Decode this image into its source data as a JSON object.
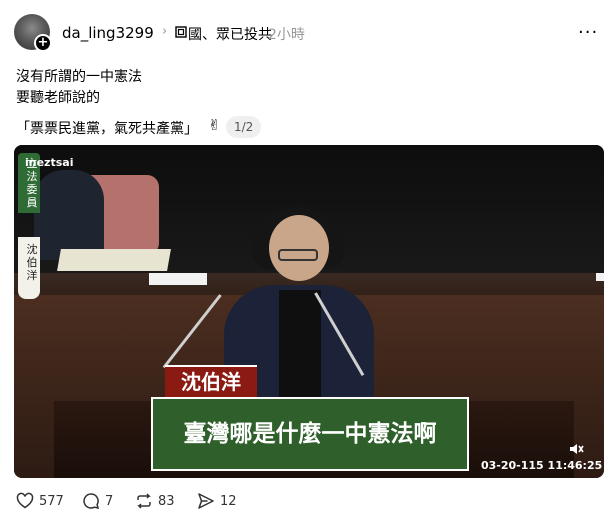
{
  "post": {
    "username": "da_ling3299",
    "community": "國、眾已投共",
    "time": "2小時",
    "body_lines": [
      "沒有所謂的一中憲法",
      "要聽老師說的"
    ],
    "quote": "「票票民進黨，氣死共產黨」",
    "hand_emoji": "✌",
    "page_indicator": "1/2"
  },
  "video": {
    "watermark": "ineztsai",
    "side_label_top": "立法委員",
    "side_label_name": "沈伯洋",
    "name_tag": "沈伯洋",
    "caption": "臺灣哪是什麼一中憲法啊",
    "timestamp": "03-20-115 11:46:25"
  },
  "actions": {
    "likes": "577",
    "comments": "7",
    "reposts": "83",
    "shares": "12"
  },
  "icons": [
    "avatar",
    "plus-icon",
    "community-icon",
    "more-icon",
    "mute-icon",
    "heart-icon",
    "comment-icon",
    "repost-icon",
    "share-icon"
  ]
}
